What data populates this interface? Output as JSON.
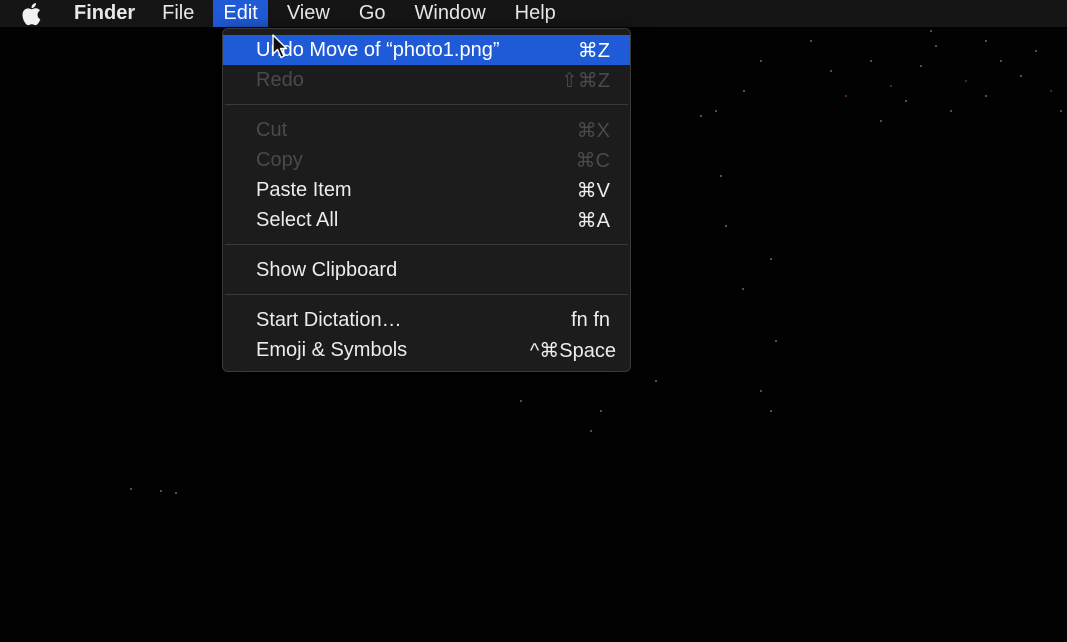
{
  "menubar": {
    "apple_icon": "apple-logo-icon",
    "items": [
      {
        "label": "Finder",
        "bold": true,
        "active": false
      },
      {
        "label": "File",
        "bold": false,
        "active": false
      },
      {
        "label": "Edit",
        "bold": false,
        "active": true
      },
      {
        "label": "View",
        "bold": false,
        "active": false
      },
      {
        "label": "Go",
        "bold": false,
        "active": false
      },
      {
        "label": "Window",
        "bold": false,
        "active": false
      },
      {
        "label": "Help",
        "bold": false,
        "active": false
      }
    ]
  },
  "edit_menu": {
    "items": [
      {
        "label": "Undo Move of “photo1.png”",
        "shortcut": "⌘Z",
        "state": "selected"
      },
      {
        "label": "Redo",
        "shortcut": "⇧⌘Z",
        "state": "disabled"
      },
      {
        "label": "Cut",
        "shortcut": "⌘X",
        "state": "disabled"
      },
      {
        "label": "Copy",
        "shortcut": "⌘C",
        "state": "disabled"
      },
      {
        "label": "Paste Item",
        "shortcut": "⌘V",
        "state": "enabled"
      },
      {
        "label": "Select All",
        "shortcut": "⌘A",
        "state": "enabled"
      },
      {
        "label": "Show Clipboard",
        "shortcut": "",
        "state": "enabled"
      },
      {
        "label": "Start Dictation…",
        "shortcut": "fn fn",
        "state": "enabled"
      },
      {
        "label": "Emoji & Symbols",
        "shortcut": "^⌘Space",
        "state": "enabled"
      }
    ]
  },
  "colors": {
    "accent": "#1f5bd6",
    "menu_bg": "#1c1c1d",
    "menubar_bg": "#151515",
    "disabled_text": "#4a4a4b"
  }
}
